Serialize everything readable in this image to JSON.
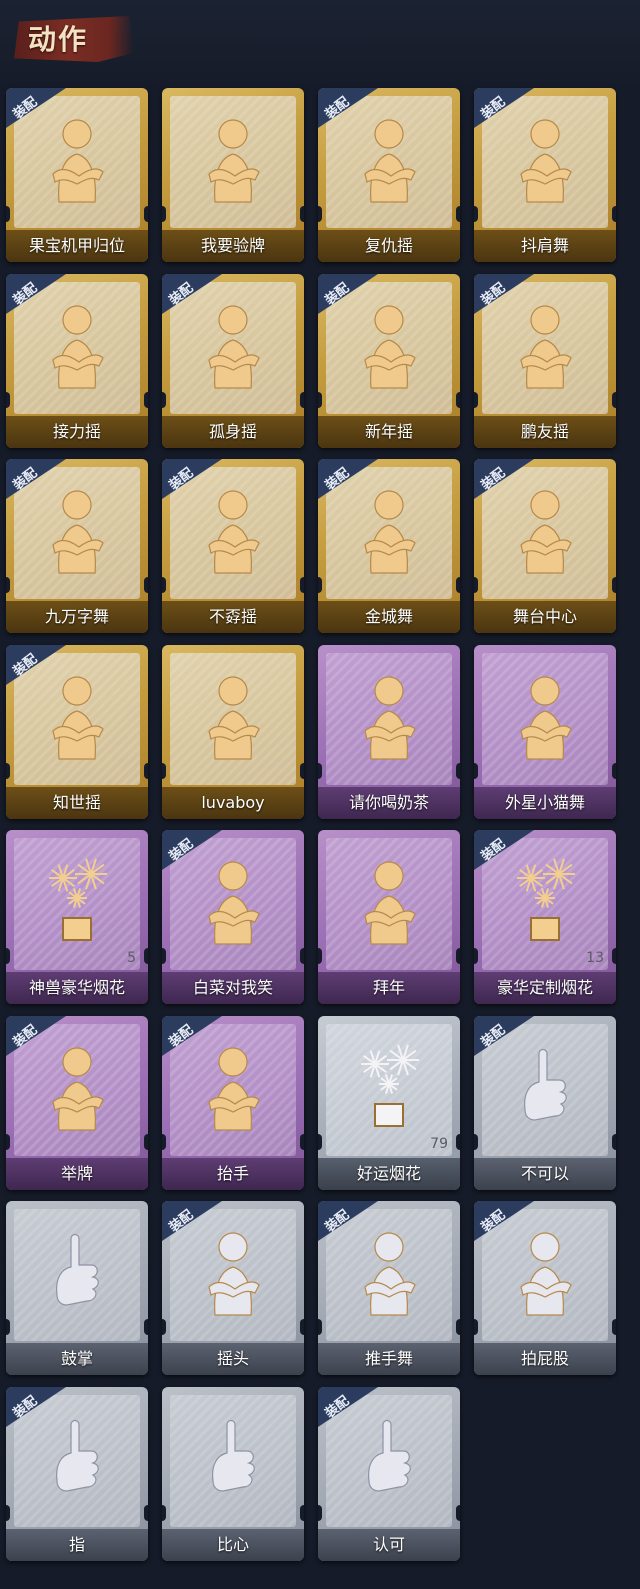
{
  "header": {
    "title": "动作"
  },
  "badge_text": "装配",
  "cards": [
    {
      "label": "果宝机甲归位",
      "equipped": true,
      "rarity": "gold",
      "icon": "pose-figure-icon",
      "count": ""
    },
    {
      "label": "我要验牌",
      "equipped": false,
      "rarity": "gold",
      "icon": "card-check-figure-icon",
      "count": ""
    },
    {
      "label": "复仇摇",
      "equipped": true,
      "rarity": "gold",
      "icon": "dance-figure-icon",
      "count": ""
    },
    {
      "label": "抖肩舞",
      "equipped": true,
      "rarity": "gold",
      "icon": "shrug-dance-figure-icon",
      "count": ""
    },
    {
      "label": "接力摇",
      "equipped": true,
      "rarity": "gold",
      "icon": "relay-dance-figure-icon",
      "count": ""
    },
    {
      "label": "孤身摇",
      "equipped": true,
      "rarity": "gold",
      "icon": "solo-dance-figure-icon",
      "count": ""
    },
    {
      "label": "新年摇",
      "equipped": true,
      "rarity": "gold",
      "icon": "newyear-dance-figure-icon",
      "count": ""
    },
    {
      "label": "鹏友摇",
      "equipped": true,
      "rarity": "gold",
      "icon": "friend-dance-figure-icon",
      "count": ""
    },
    {
      "label": "九万字舞",
      "equipped": true,
      "rarity": "gold",
      "icon": "swirl-dance-figure-icon",
      "count": ""
    },
    {
      "label": "不孬摇",
      "equipped": true,
      "rarity": "gold",
      "icon": "arm-up-figure-icon",
      "count": ""
    },
    {
      "label": "金城舞",
      "equipped": true,
      "rarity": "gold",
      "icon": "wave-figure-icon",
      "count": ""
    },
    {
      "label": "舞台中心",
      "equipped": true,
      "rarity": "gold",
      "icon": "stage-figure-icon",
      "count": ""
    },
    {
      "label": "知世摇",
      "equipped": true,
      "rarity": "gold",
      "icon": "music-figure-icon",
      "count": ""
    },
    {
      "label": "luvaboy",
      "equipped": false,
      "rarity": "gold",
      "icon": "cross-arm-figure-icon",
      "count": ""
    },
    {
      "label": "请你喝奶茶",
      "equipped": false,
      "rarity": "purple",
      "icon": "milk-tea-sign-figure-icon",
      "count": ""
    },
    {
      "label": "外星小猫舞",
      "equipped": false,
      "rarity": "purple",
      "icon": "alien-cat-figure-icon",
      "count": ""
    },
    {
      "label": "神兽豪华烟花",
      "equipped": false,
      "rarity": "purple",
      "icon": "fireworks-box-icon",
      "count": "5"
    },
    {
      "label": "白菜对我笑",
      "equipped": true,
      "rarity": "purple",
      "icon": "cabbage-figure-icon",
      "count": ""
    },
    {
      "label": "拜年",
      "equipped": false,
      "rarity": "purple",
      "icon": "greeting-figure-icon",
      "count": ""
    },
    {
      "label": "豪华定制烟花",
      "equipped": true,
      "rarity": "purple",
      "icon": "fireworks-gift-icon",
      "count": "13"
    },
    {
      "label": "举牌",
      "equipped": true,
      "rarity": "purple",
      "icon": "hold-sign-figure-icon",
      "count": ""
    },
    {
      "label": "抬手",
      "equipped": true,
      "rarity": "purple",
      "icon": "raise-hand-figure-icon",
      "count": ""
    },
    {
      "label": "好运烟花",
      "equipped": false,
      "rarity": "silver",
      "icon": "lucky-fireworks-icon",
      "count": "79"
    },
    {
      "label": "不可以",
      "equipped": true,
      "rarity": "grey",
      "icon": "finger-no-icon",
      "count": ""
    },
    {
      "label": "鼓掌",
      "equipped": false,
      "rarity": "grey",
      "icon": "clap-hands-icon",
      "count": ""
    },
    {
      "label": "摇头",
      "equipped": true,
      "rarity": "grey",
      "icon": "shake-head-figure-icon",
      "count": ""
    },
    {
      "label": "推手舞",
      "equipped": true,
      "rarity": "grey",
      "icon": "push-dance-figure-icon",
      "count": ""
    },
    {
      "label": "拍屁股",
      "equipped": true,
      "rarity": "grey",
      "icon": "slap-figure-icon",
      "count": ""
    },
    {
      "label": "指",
      "equipped": true,
      "rarity": "grey",
      "icon": "point-hand-icon",
      "count": ""
    },
    {
      "label": "比心",
      "equipped": false,
      "rarity": "grey",
      "icon": "finger-heart-icon",
      "count": ""
    },
    {
      "label": "认可",
      "equipped": true,
      "rarity": "grey",
      "icon": "thumbs-up-icon",
      "count": ""
    }
  ]
}
